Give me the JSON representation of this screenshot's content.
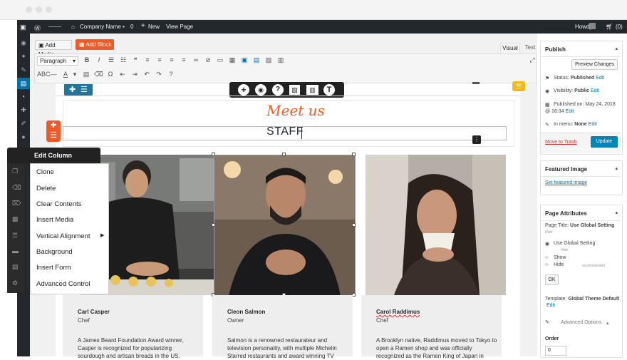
{
  "admin_bar": {
    "site_name": "Company Name",
    "comments_count": "0",
    "new_label": "New",
    "view_page_label": "View Page",
    "howdy_label": "Howdy",
    "cart_count": "(0)"
  },
  "editor": {
    "add_media_label": "Add Media",
    "add_block_label": "Add Block",
    "visual_tab": "Visual",
    "text_tab": "Text",
    "format_select": "Paragraph"
  },
  "page": {
    "heading_script": "Meet us",
    "heading_main": "STAFF"
  },
  "team": [
    {
      "name": "Carl Casper",
      "role": "Chef",
      "bio": "A James Beard Foundation Award winner, Casper is recognized for popularizing sourdough and artisan breads in the US."
    },
    {
      "name": "Cleon Salmon",
      "role": "Owner",
      "bio": "Salmon is a renowned restaurateur and television personality, with multiple Michelin Starred restaurants and award winning TV"
    },
    {
      "name": "Carol Raddimus",
      "role": "Chef",
      "bio": "A Brooklyn native, Raddimus moved to Tokyo to open a Ramen shop and was officially recognized as the Ramen King of Japan in"
    }
  ],
  "context_menu": {
    "title": "Edit Column",
    "items": [
      "Clone",
      "Delete",
      "Clear Contents",
      "Insert Media",
      "Vertical Alignment",
      "Background",
      "Insert Form",
      "Advanced Control"
    ]
  },
  "publish_box": {
    "title": "Publish",
    "preview_button": "Preview Changes",
    "status_label": "Status:",
    "status_value": "Published",
    "visibility_label": "Visibility:",
    "visibility_value": "Public",
    "published_on": "Published on: May 24, 2018",
    "published_time": "@ 16:34",
    "edit_label": "Edit",
    "in_menu_label": "In menu:",
    "in_menu_value": "None",
    "trash_link": "Move to Trash",
    "update_button": "Update"
  },
  "featured_image_box": {
    "title": "Featured Image",
    "link": "Set featured image"
  },
  "page_attributes_box": {
    "title": "Page Attributes",
    "page_title_label": "Page Title:",
    "page_title_value": "Use Global Setting",
    "hide_note": "Hide",
    "options": [
      "Use Global Setting",
      "Show",
      "Hide"
    ],
    "recommended": "recommended",
    "ok_button": "OK",
    "template_label": "Template:",
    "template_value": "Global Theme Default",
    "advanced_options": "Advanced Options",
    "order_label": "Order",
    "order_value": "0"
  },
  "colors": {
    "accent_orange": "#f15a24",
    "wp_blue": "#0073aa",
    "link_red": "#dc3232"
  }
}
